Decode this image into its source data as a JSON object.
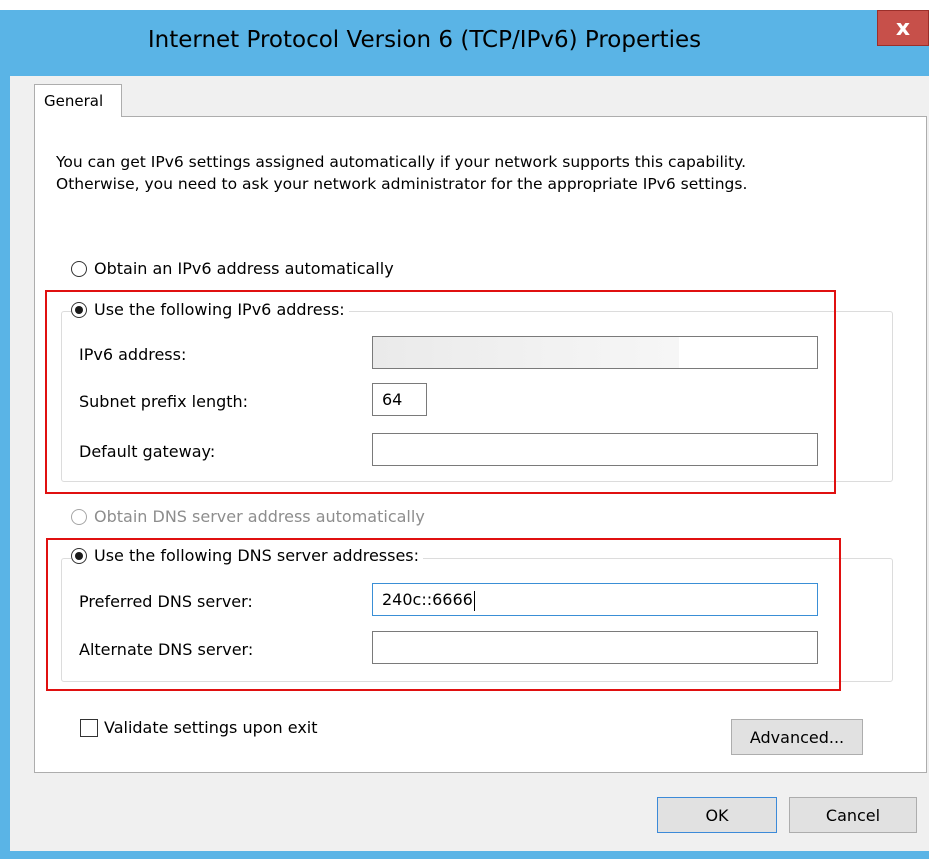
{
  "window": {
    "title": "Internet Protocol Version 6 (TCP/IPv6) Properties",
    "close_label": "x"
  },
  "tabs": [
    {
      "label": "General"
    }
  ],
  "general": {
    "description_line1": "You can get IPv6 settings assigned automatically if your network supports this capability.",
    "description_line2": "Otherwise, you need to ask your network administrator for the appropriate IPv6 settings.",
    "obtain_auto_label": "Obtain an IPv6 address automatically",
    "use_following_label": "Use the following IPv6 address:",
    "ipv6_address_label": "IPv6 address:",
    "ipv6_address_value": "",
    "subnet_prefix_label": "Subnet prefix length:",
    "subnet_prefix_value": "64",
    "default_gateway_label": "Default gateway:",
    "default_gateway_value": "",
    "obtain_dns_auto_label": "Obtain DNS server address automatically",
    "use_following_dns_label": "Use the following DNS server addresses:",
    "preferred_dns_label": "Preferred DNS server:",
    "preferred_dns_value": "240c::6666",
    "alternate_dns_label": "Alternate DNS server:",
    "alternate_dns_value": "",
    "validate_label": "Validate settings upon exit",
    "validate_checked": false,
    "advanced_label": "Advanced..."
  },
  "footer": {
    "ok_label": "OK",
    "cancel_label": "Cancel"
  },
  "colors": {
    "title_bar": "#5ab4e6",
    "close_button": "#c7504a",
    "highlight_box": "#e01010"
  }
}
